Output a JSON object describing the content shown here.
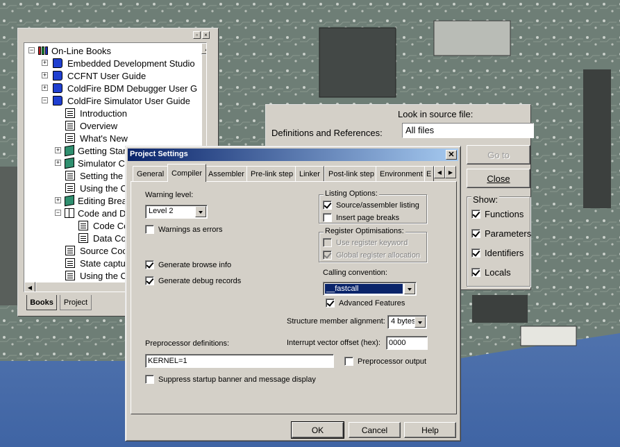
{
  "books_window": {
    "tree": [
      {
        "label": "On-Line Books",
        "icon": "bookshelf-icon",
        "level": 0,
        "expander": "-"
      },
      {
        "label": "Embedded Development Studio",
        "icon": "book-icon",
        "level": 1,
        "expander": "+"
      },
      {
        "label": "CCFNT User Guide",
        "icon": "book-icon",
        "level": 1,
        "expander": "+"
      },
      {
        "label": "ColdFire BDM Debugger User G",
        "icon": "book-icon",
        "level": 1,
        "expander": "+"
      },
      {
        "label": "ColdFire Simulator User Guide",
        "icon": "book-icon",
        "level": 1,
        "expander": "-"
      },
      {
        "label": "Introduction",
        "icon": "page-icon",
        "level": 2,
        "expander": ""
      },
      {
        "label": "Overview",
        "icon": "page-icon",
        "level": 2,
        "expander": ""
      },
      {
        "label": "What's New",
        "icon": "page-icon",
        "level": 2,
        "expander": ""
      },
      {
        "label": "Getting Star",
        "icon": "closed-book-icon",
        "level": 2,
        "expander": "+"
      },
      {
        "label": "Simulator C",
        "icon": "closed-book-icon",
        "level": 2,
        "expander": "+"
      },
      {
        "label": "Setting the F",
        "icon": "page-icon",
        "level": 2,
        "expander": ""
      },
      {
        "label": "Using the C",
        "icon": "page-icon",
        "level": 2,
        "expander": ""
      },
      {
        "label": "Editing Brea",
        "icon": "closed-book-icon",
        "level": 2,
        "expander": "+"
      },
      {
        "label": "Code and D",
        "icon": "open-book-icon",
        "level": 2,
        "expander": "-"
      },
      {
        "label": "Code Co",
        "icon": "page-icon",
        "level": 3,
        "expander": ""
      },
      {
        "label": "Data Co",
        "icon": "page-icon",
        "level": 3,
        "expander": ""
      },
      {
        "label": "Source Coc",
        "icon": "page-icon",
        "level": 2,
        "expander": ""
      },
      {
        "label": "State captu",
        "icon": "page-icon",
        "level": 2,
        "expander": ""
      },
      {
        "label": "Using the C",
        "icon": "page-icon",
        "level": 2,
        "expander": ""
      }
    ],
    "tabs": [
      "Books",
      "Project"
    ]
  },
  "browse_window": {
    "look_in_label": "Look in source file:",
    "definitions_label": "Definitions and References:",
    "look_in_value": "All files",
    "goto_label": "Go to",
    "close_label": "Close",
    "show_label": "Show:",
    "show_options": [
      {
        "label": "Functions",
        "checked": true
      },
      {
        "label": "Parameters",
        "checked": true
      },
      {
        "label": "Identifiers",
        "checked": true
      },
      {
        "label": "Locals",
        "checked": true
      }
    ]
  },
  "dialog": {
    "title": "Project Settings",
    "tabs": [
      "General",
      "Compiler",
      "Assembler",
      "Pre-link step",
      "Linker",
      "Post-link step",
      "Environment",
      "E"
    ],
    "active_tab": "Compiler",
    "warning_level_label": "Warning level:",
    "warning_level_value": "Level 2",
    "warnings_as_errors": {
      "label": "Warnings as errors",
      "checked": false
    },
    "generate_browse": {
      "label": "Generate browse info",
      "checked": true
    },
    "generate_debug": {
      "label": "Generate debug records",
      "checked": true
    },
    "listing_options": {
      "title": "Listing Options:",
      "source_listing": {
        "label": "Source/assembler listing",
        "checked": true
      },
      "page_breaks": {
        "label": "Insert page breaks",
        "checked": false
      }
    },
    "register_opt": {
      "title": "Register Optimisations:",
      "use_register": {
        "label": "Use register keyword",
        "checked": false
      },
      "global_alloc": {
        "label": "Global register allocation",
        "checked": true
      }
    },
    "calling_convention_label": "Calling convention:",
    "calling_convention_value": "__fastcall",
    "advanced_features": {
      "label": "Advanced Features",
      "checked": true
    },
    "struct_align_label": "Structure member alignment:",
    "struct_align_value": "4 bytes",
    "interrupt_offset_label": "Interrupt vector offset (hex):",
    "interrupt_offset_value": "0000",
    "preprocessor_defs_label": "Preprocessor definitions:",
    "preprocessor_defs_value": "KERNEL=1",
    "preprocessor_output": {
      "label": "Preprocessor output",
      "checked": false
    },
    "suppress_banner": {
      "label": "Suppress startup banner and message display",
      "checked": false
    },
    "ok_label": "OK",
    "cancel_label": "Cancel",
    "help_label": "Help"
  },
  "colors": {
    "face": "#d4d0c8",
    "title_start": "#0a246a",
    "title_end": "#a6caf0",
    "selection": "#0a246a",
    "desktop": "#5f80b0",
    "board": "#6f7f77"
  }
}
